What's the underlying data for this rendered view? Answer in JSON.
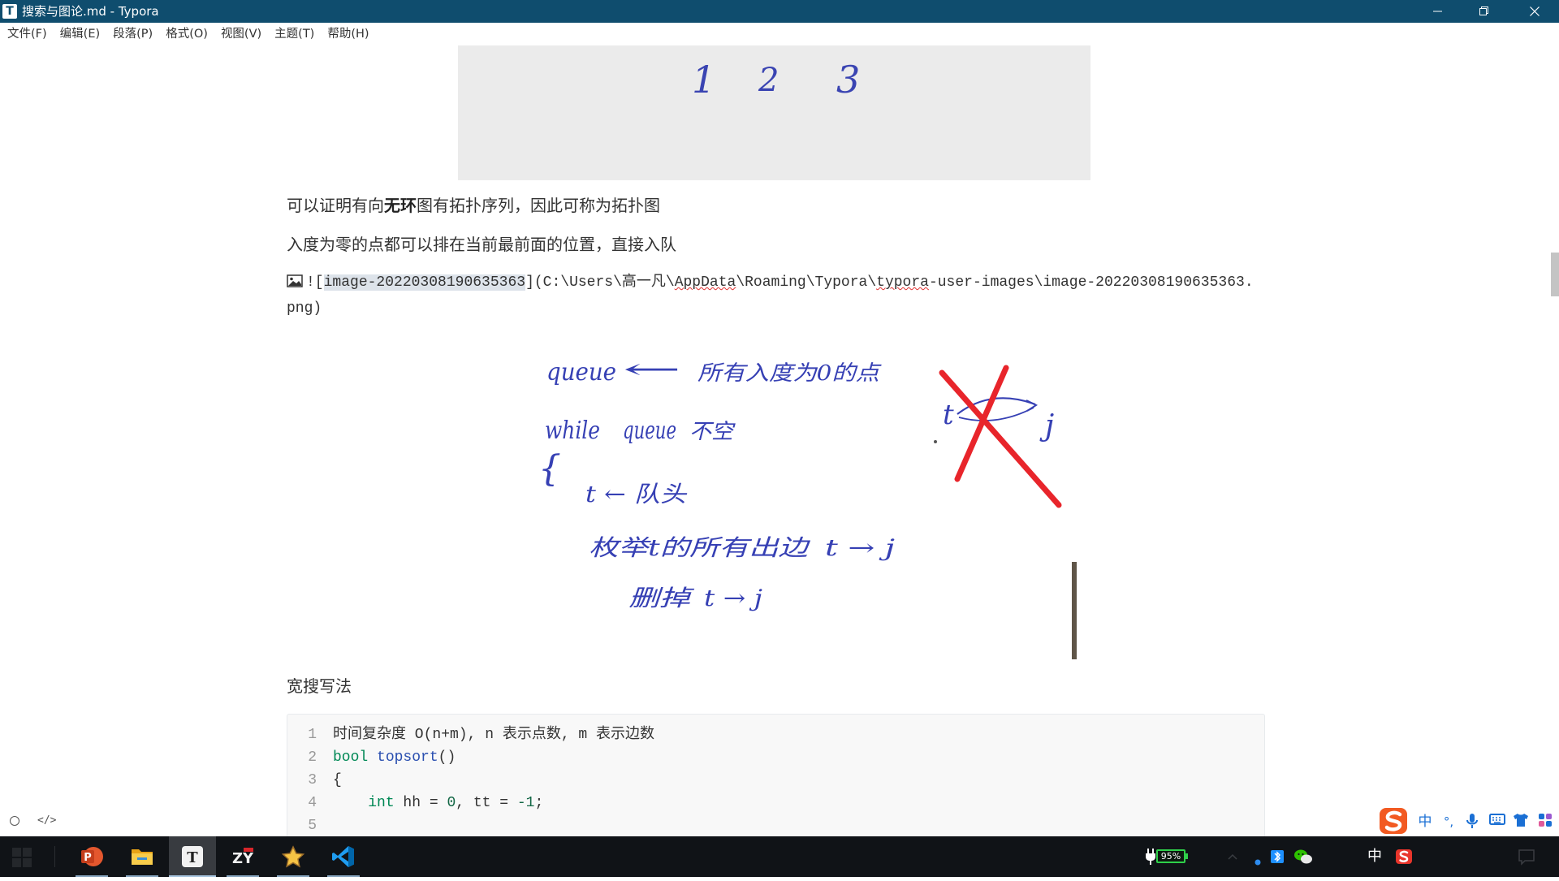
{
  "window": {
    "title": "搜索与图论.md - Typora",
    "app_icon_letter": "T",
    "controls": [
      "minimize-icon",
      "restore-icon",
      "close-icon"
    ]
  },
  "menu": [
    {
      "label": "文件(F)"
    },
    {
      "label": "编辑(E)"
    },
    {
      "label": "段落(P)"
    },
    {
      "label": "格式(O)"
    },
    {
      "label": "视图(V)"
    },
    {
      "label": "主题(T)"
    },
    {
      "label": "帮助(H)"
    }
  ],
  "document": {
    "figure_top": {
      "digits": [
        "1",
        "2",
        "3"
      ],
      "background": "#ebebeb",
      "ink_color": "#3a44b2"
    },
    "para_acyclic": {
      "before": "可以证明有向",
      "bold": "无环",
      "after": "图有拓扑序列，因此可称为拓扑图"
    },
    "para_indegree": "入度为零的点都可以排在当前最前面的位置，直接入队",
    "image_source": {
      "icon": "image-icon",
      "open": "![",
      "alt": "image-20220308190635363",
      "path_start": "](C:\\Users\\高一凡\\",
      "path_word1": "AppData",
      "path_mid": "\\Roaming\\Typora\\",
      "path_word2": "typora",
      "path_end": "-user-images\\image-20220308190635363.",
      "path_tail": "png)"
    },
    "sketch": {
      "l1_word": "queue",
      "l1_arrow": "←",
      "l1_text": "所有入度为0的点",
      "l2_word": "while",
      "l2_queue": "queue",
      "l2_text": "不空",
      "brace": "{",
      "l3": "t ← 队头",
      "l4_text": "枚举t的所有出边",
      "l4_edge": "t → j",
      "l5_text": "删掉",
      "l5_edge": "t → j",
      "crossed_t": "t",
      "crossed_j": "j",
      "ink_color": "#3640b4",
      "cross_color": "#e8252b"
    },
    "heading_bfs": "宽搜写法",
    "code": {
      "lines": [
        {
          "n": "1",
          "tokens": [
            {
              "t": "时间复杂度 O(n+m), n 表示点数, m 表示边数"
            }
          ]
        },
        {
          "n": "2",
          "tokens": [
            {
              "t": "bool",
              "color": "#008855"
            },
            {
              "t": " "
            },
            {
              "t": "topsort",
              "color": "#2a4fb0"
            },
            {
              "t": "()"
            }
          ]
        },
        {
          "n": "3",
          "tokens": [
            {
              "t": "{"
            }
          ]
        },
        {
          "n": "4",
          "tokens": [
            {
              "t": "    "
            },
            {
              "t": "int",
              "color": "#008855"
            },
            {
              "t": " hh = "
            },
            {
              "t": "0",
              "color": "#116644"
            },
            {
              "t": ", tt = "
            },
            {
              "t": "-1",
              "color": "#116644"
            },
            {
              "t": ";"
            }
          ]
        },
        {
          "n": "5",
          "tokens": []
        }
      ]
    }
  },
  "status_bar": {
    "icons": [
      "circle-outline-icon",
      "source-code-icon"
    ],
    "source_label": "</>"
  },
  "ime_toolbar": {
    "logo": "sogou-logo-icon",
    "mode": "中",
    "punct": "°,",
    "icons": [
      "microphone-icon",
      "keyboard-icon",
      "skin-shirt-icon",
      "toolbox-grid-icon"
    ]
  },
  "taskbar": {
    "start_icon": "windows-start-icon",
    "apps": [
      {
        "icon": "powerpoint-icon",
        "letter": "P"
      },
      {
        "icon": "file-explorer-icon"
      },
      {
        "icon": "typora-icon",
        "letter": "T",
        "active": true
      },
      {
        "icon": "zy-app-icon",
        "letter": "ZY"
      },
      {
        "icon": "star-app-icon"
      },
      {
        "icon": "vscode-icon"
      }
    ]
  },
  "tray": {
    "battery": "95%",
    "ime": "中",
    "icons": [
      "power-plug-icon",
      "show-hidden-icons-chevron-icon",
      "notification-dot-icon",
      "bluetooth-icon",
      "wechat-icon",
      "sogou-icon",
      "action-center-icon"
    ]
  },
  "colors": {
    "titlebar": "#0f4d6e",
    "taskbar": "#101317",
    "battery": "#2fd04a",
    "ime_blue": "#1a6fd4",
    "sogou_orange": "#f25a22"
  }
}
